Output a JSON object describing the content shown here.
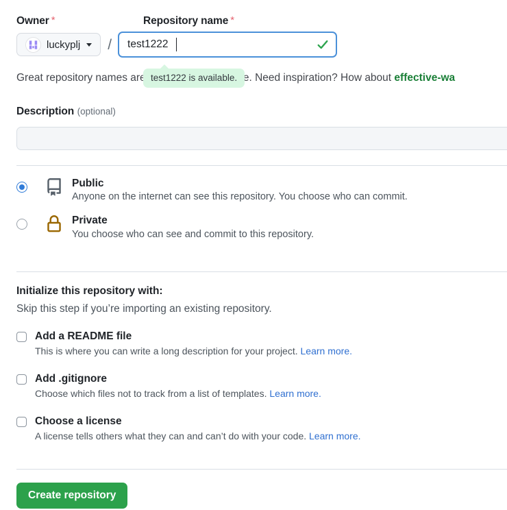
{
  "owner": {
    "label": "Owner",
    "required_mark": "*",
    "name": "luckyplj",
    "avatar_icon": "identicon-avatar",
    "caret_icon": "chevron-down-icon"
  },
  "repository_name": {
    "label": "Repository name",
    "required_mark": "*",
    "value": "test1222",
    "placeholder": "",
    "separator": "/",
    "valid_icon": "check-icon",
    "availability_tooltip": "test1222 is available."
  },
  "hint": {
    "text_before": "Great repository names ",
    "text_hidden": "are short and memo",
    "text_after": "rable. Need inspiration? How about ",
    "suggestion": "effective-wa"
  },
  "description": {
    "label": "Description",
    "optional_note": "(optional)",
    "value": "",
    "placeholder": ""
  },
  "visibility": {
    "options": [
      {
        "id": "public",
        "title": "Public",
        "description": "Anyone on the internet can see this repository. You choose who can commit.",
        "icon": "repo-icon",
        "icon_color": "#57606a",
        "selected": true
      },
      {
        "id": "private",
        "title": "Private",
        "description": "You choose who can see and commit to this repository.",
        "icon": "lock-icon",
        "icon_color": "#9a6700",
        "selected": false
      }
    ]
  },
  "initialize": {
    "title": "Initialize this repository with:",
    "subtitle": "Skip this step if you’re importing an existing repository.",
    "items": [
      {
        "id": "readme",
        "label": "Add a README file",
        "description": "This is where you can write a long description for your project.",
        "learn_more": "Learn more.",
        "checked": false
      },
      {
        "id": "gitignore",
        "label": "Add .gitignore",
        "description": "Choose which files not to track from a list of templates.",
        "learn_more": "Learn more.",
        "checked": false
      },
      {
        "id": "license",
        "label": "Choose a license",
        "description": "A license tells others what they can and can’t do with your code.",
        "learn_more": "Learn more.",
        "checked": false
      }
    ]
  },
  "submit": {
    "label": "Create repository",
    "color": "#2ca14b"
  },
  "colors": {
    "accent_blue": "#2f7bd8",
    "link_blue": "#2f6fd0",
    "green": "#1a7f37",
    "required_red": "#e5636f",
    "tooltip_green_bg": "#d7f6e1",
    "border": "#d8dee4"
  }
}
